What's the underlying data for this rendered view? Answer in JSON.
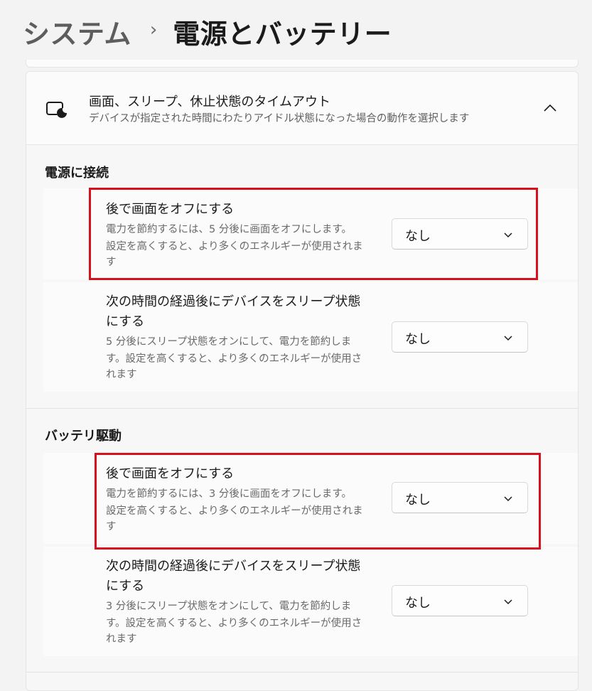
{
  "breadcrumb": {
    "parent": "システム",
    "separator": "›",
    "current": "電源とバッテリー"
  },
  "section": {
    "title": "画面、スリープ、休止状態のタイムアウト",
    "description": "デバイスが指定された時間にわたりアイドル状態になった場合の動作を選択します",
    "icon": "screen-sleep-icon",
    "collapse_icon": "chevron-up-icon"
  },
  "groups": [
    {
      "title": "電源に接続",
      "rows": [
        {
          "title_lines": [
            "後で画面をオフにする"
          ],
          "desc_lines": [
            "電力を節約するには、5 分後に画面をオフにします。",
            "設定を高くすると、より多くのエネルギーが使用されま",
            "す"
          ],
          "value": "なし"
        },
        {
          "title_lines": [
            "次の時間の経過後にデバイスをスリープ状態",
            "にする"
          ],
          "desc_lines": [
            "5 分後にスリープ状態をオンにして、電力を節約しま",
            "す。設定を高くすると、より多くのエネルギーが使用さ",
            "れます"
          ],
          "value": "なし"
        }
      ]
    },
    {
      "title": "バッテリ駆動",
      "rows": [
        {
          "title_lines": [
            "後で画面をオフにする"
          ],
          "desc_lines": [
            "電力を節約するには、3 分後に画面をオフにします。",
            "設定を高くすると、より多くのエネルギーが使用されま",
            "す"
          ],
          "value": "なし"
        },
        {
          "title_lines": [
            "次の時間の経過後にデバイスをスリープ状態",
            "にする"
          ],
          "desc_lines": [
            "3 分後にスリープ状態をオンにして、電力を節約しま",
            "す。設定を高くすると、より多くのエネルギーが使用さ",
            "れます"
          ],
          "value": "なし"
        }
      ]
    }
  ],
  "colors": {
    "highlight": "#d8101c",
    "background": "#f3f3f3",
    "card": "#fbfbfb"
  }
}
